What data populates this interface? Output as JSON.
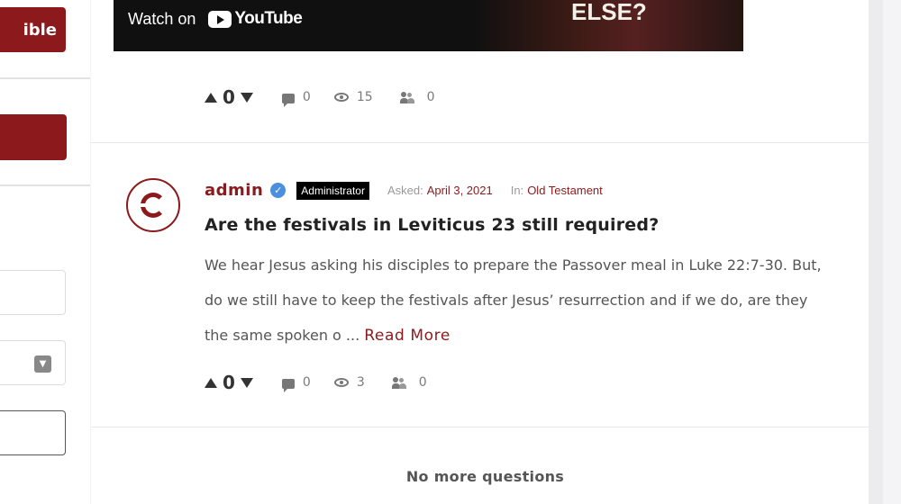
{
  "sidebar": {
    "top_button_label": "ible"
  },
  "video": {
    "watch_on": "Watch on",
    "platform": "YouTube",
    "overlay_text": "ELSE?"
  },
  "prev_question": {
    "votes": "0",
    "comments": "0",
    "views": "15",
    "followers": "0"
  },
  "question": {
    "author": "admin",
    "badge": "Administrator",
    "asked_label": "Asked:",
    "asked_date": "April 3, 2021",
    "in_label": "In:",
    "category": "Old Testament",
    "title": "Are the festivals in Leviticus 23 still required?",
    "excerpt": "We hear Jesus asking his disciples to prepare the Passover meal in Luke 22:7-30. But, do we still have to keep the festivals after Jesus’ resurrection and if we do, are they the same spoken o ...",
    "read_more": "Read More",
    "votes": "0",
    "comments": "0",
    "views": "3",
    "followers": "0"
  },
  "footer_message": "No more questions",
  "colors": {
    "brand": "#8c1a1c",
    "verified": "#4a8fe0",
    "badge_bg": "#000000"
  },
  "icons": [
    "vote-up-icon",
    "vote-down-icon",
    "comment-icon",
    "eye-icon",
    "users-icon",
    "verified-icon",
    "chevron-down-icon",
    "youtube-icon"
  ]
}
